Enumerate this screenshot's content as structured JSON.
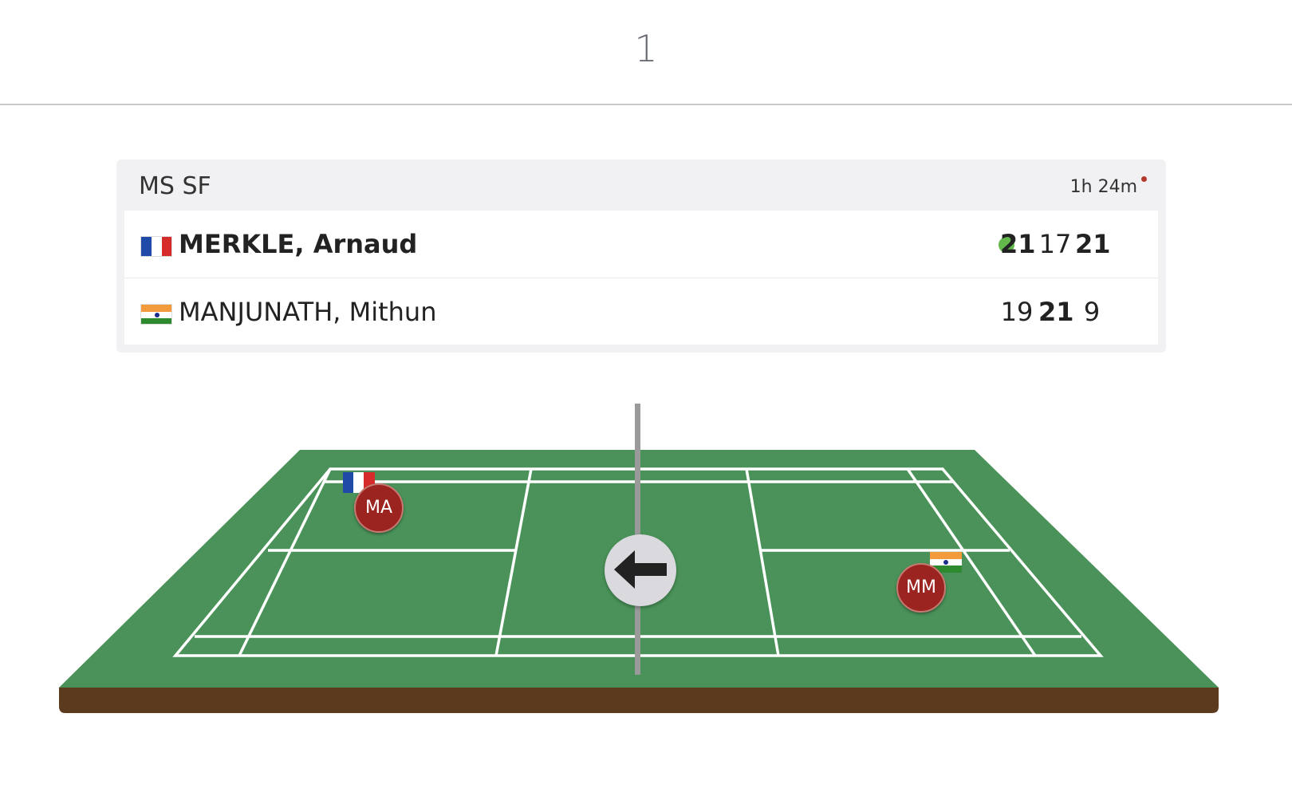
{
  "court_number": "1",
  "match": {
    "event": "MS SF",
    "duration": "1h 24m",
    "players": [
      {
        "name": "MERKLE, Arnaud",
        "country": "France",
        "winner": true,
        "serving": true,
        "games": [
          "21",
          "17",
          "21"
        ],
        "games_won": [
          true,
          false,
          true
        ]
      },
      {
        "name": "MANJUNATH, Mithun",
        "country": "India",
        "winner": false,
        "serving": false,
        "games": [
          "19",
          "21",
          "9"
        ],
        "games_won": [
          false,
          true,
          false
        ]
      }
    ]
  },
  "court": {
    "players": [
      {
        "initials": "MA",
        "country": "France"
      },
      {
        "initials": "MM",
        "country": "India"
      }
    ],
    "direction_icon": "arrow-left-icon"
  },
  "colors": {
    "court_green": "#4a9259",
    "court_base": "#5b3a1e",
    "player_marker": "#9b2421",
    "serve_indicator": "#63b94c",
    "live_dot": "#b3392f"
  }
}
